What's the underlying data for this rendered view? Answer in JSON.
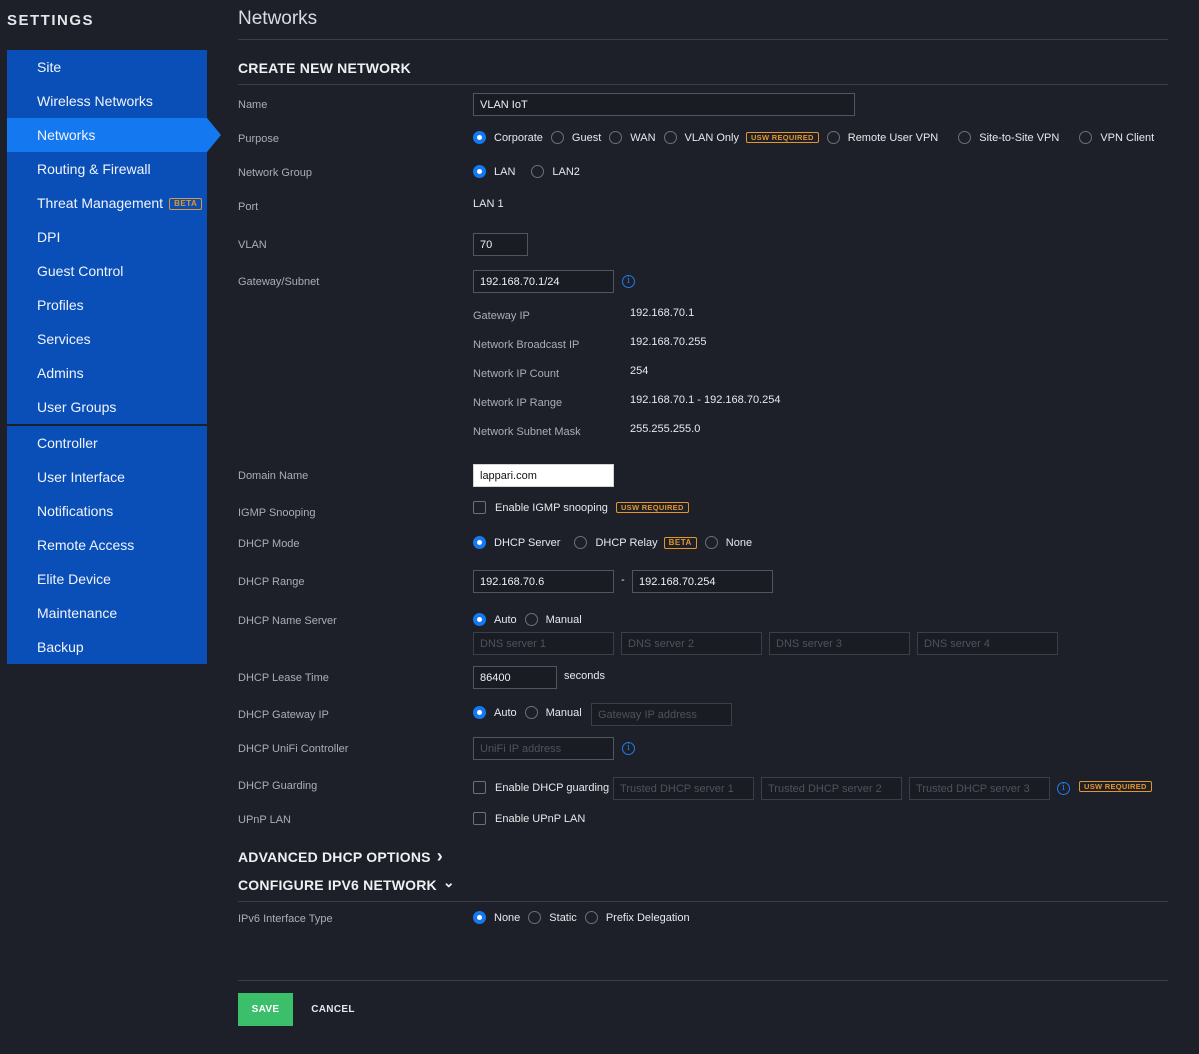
{
  "sidebar": {
    "title": "SETTINGS",
    "group1": [
      {
        "label": "Site"
      },
      {
        "label": "Wireless Networks"
      },
      {
        "label": "Networks",
        "active": true
      },
      {
        "label": "Routing & Firewall"
      },
      {
        "label": "Threat Management",
        "badge": "BETA"
      },
      {
        "label": "DPI"
      },
      {
        "label": "Guest Control"
      },
      {
        "label": "Profiles"
      },
      {
        "label": "Services"
      },
      {
        "label": "Admins"
      },
      {
        "label": "User Groups"
      }
    ],
    "group2": [
      {
        "label": "Controller"
      },
      {
        "label": "User Interface"
      },
      {
        "label": "Notifications"
      },
      {
        "label": "Remote Access"
      },
      {
        "label": "Elite Device"
      },
      {
        "label": "Maintenance"
      },
      {
        "label": "Backup"
      }
    ]
  },
  "page": {
    "title": "Networks",
    "section": "CREATE NEW NETWORK"
  },
  "form": {
    "name": {
      "label": "Name",
      "value": "VLAN IoT"
    },
    "purpose": {
      "label": "Purpose",
      "options": [
        "Corporate",
        "Guest",
        "WAN",
        "VLAN Only",
        "Remote User VPN",
        "Site-to-Site VPN",
        "VPN Client"
      ],
      "selected": "Corporate",
      "vlan_only_badge": "USW REQUIRED"
    },
    "network_group": {
      "label": "Network Group",
      "options": [
        "LAN",
        "LAN2"
      ],
      "selected": "LAN"
    },
    "port": {
      "label": "Port",
      "value": "LAN 1"
    },
    "vlan": {
      "label": "VLAN",
      "value": "70"
    },
    "gateway_subnet": {
      "label": "Gateway/Subnet",
      "value": "192.168.70.1/24",
      "info_icon": "i",
      "details": [
        {
          "label": "Gateway IP",
          "value": "192.168.70.1"
        },
        {
          "label": "Network Broadcast IP",
          "value": "192.168.70.255"
        },
        {
          "label": "Network IP Count",
          "value": "254"
        },
        {
          "label": "Network IP Range",
          "value": "192.168.70.1 - 192.168.70.254"
        },
        {
          "label": "Network Subnet Mask",
          "value": "255.255.255.0"
        }
      ]
    },
    "domain_name": {
      "label": "Domain Name",
      "value": "lappari.com"
    },
    "igmp": {
      "label": "IGMP Snooping",
      "checkbox_label": "Enable IGMP snooping",
      "badge": "USW REQUIRED",
      "checked": false
    },
    "dhcp_mode": {
      "label": "DHCP Mode",
      "options": [
        "DHCP Server",
        "DHCP Relay",
        "None"
      ],
      "selected": "DHCP Server",
      "relay_badge": "BETA"
    },
    "dhcp_range": {
      "label": "DHCP Range",
      "start": "192.168.70.6",
      "separator": "-",
      "end": "192.168.70.254"
    },
    "dhcp_name_server": {
      "label": "DHCP Name Server",
      "options": [
        "Auto",
        "Manual"
      ],
      "selected": "Auto",
      "placeholders": [
        "DNS server 1",
        "DNS server 2",
        "DNS server 3",
        "DNS server 4"
      ]
    },
    "lease_time": {
      "label": "DHCP Lease Time",
      "value": "86400",
      "unit": "seconds"
    },
    "dhcp_gateway": {
      "label": "DHCP Gateway IP",
      "options": [
        "Auto",
        "Manual"
      ],
      "selected": "Auto",
      "placeholder": "Gateway IP address"
    },
    "unifi_controller": {
      "label": "DHCP UniFi Controller",
      "placeholder": "UniFi IP address",
      "info_icon": "i"
    },
    "dhcp_guarding": {
      "label": "DHCP Guarding",
      "checkbox_label": "Enable DHCP guarding",
      "checked": false,
      "placeholders": [
        "Trusted DHCP server 1",
        "Trusted DHCP server 2",
        "Trusted DHCP server 3"
      ],
      "info_icon": "i",
      "badge": "USW REQUIRED"
    },
    "upnp": {
      "label": "UPnP LAN",
      "checkbox_label": "Enable UPnP LAN",
      "checked": false
    }
  },
  "advanced": {
    "title": "ADVANCED DHCP OPTIONS",
    "chevron": "›"
  },
  "ipv6": {
    "title": "CONFIGURE IPV6 NETWORK",
    "chevron": "⌄",
    "interface_type": {
      "label": "IPv6 Interface Type",
      "options": [
        "None",
        "Static",
        "Prefix Delegation"
      ],
      "selected": "None"
    }
  },
  "actions": {
    "save": "SAVE",
    "cancel": "CANCEL"
  },
  "colors": {
    "accent": "#1478f0",
    "sidebar": "#0a4fb8",
    "save": "#3bbf6b",
    "badge": "#e3962b",
    "background": "#1e2029"
  }
}
